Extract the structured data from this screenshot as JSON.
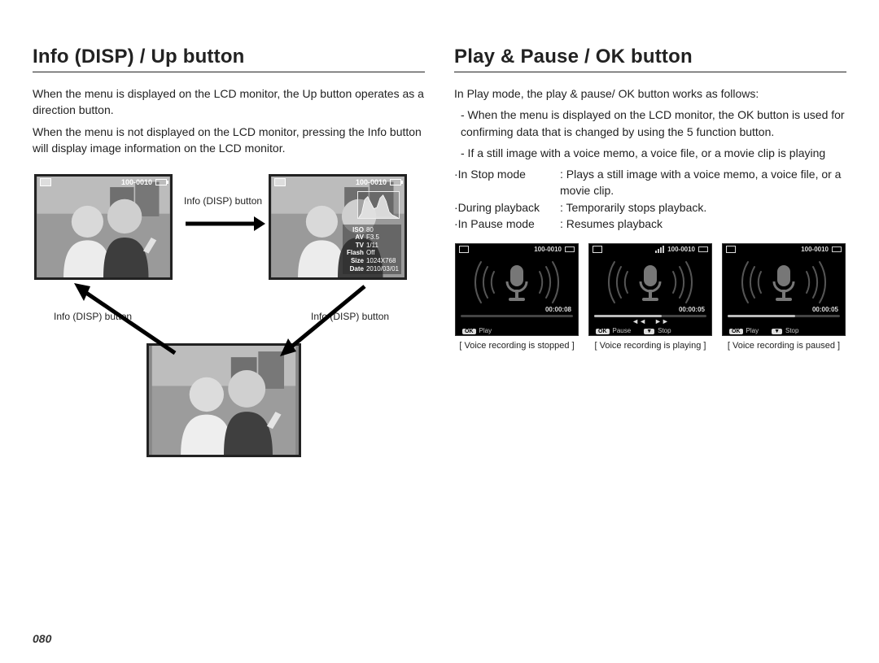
{
  "page_number": "080",
  "left": {
    "heading": "Info (DISP) / Up button",
    "p1": "When the menu is displayed on the LCD monitor, the Up button operates as a direction button.",
    "p2": "When the menu is not displayed on the LCD monitor, pressing the Info button will display image information on the LCD monitor.",
    "diagram": {
      "label_right": "Info (DISP) button",
      "label_bl": "Info (DISP) button",
      "label_br": "Info (DISP) button",
      "file_num": "100-0010",
      "meta": {
        "iso_lbl": "ISO",
        "iso_val": "80",
        "av_lbl": "AV",
        "av_val": "F3.5",
        "tv_lbl": "TV",
        "tv_val": "1/11",
        "flash_lbl": "Flash",
        "flash_val": "Off",
        "size_lbl": "Size",
        "size_val": "1024X768",
        "date_lbl": "Date",
        "date_val": "2010/03/01"
      }
    }
  },
  "right": {
    "heading": "Play & Pause / OK button",
    "p1": "In Play mode, the play & pause/ OK button works as follows:",
    "b1": "- When the menu is displayed on the LCD monitor, the OK button is used for confirming data that is changed by using the 5 function button.",
    "b2": "- If a still image with a voice memo, a voice file, or a movie clip is playing",
    "modes": [
      {
        "label": "·In Stop mode",
        "value": ": Plays a still image with a voice memo, a voice file, or a movie clip."
      },
      {
        "label": "·During playback",
        "value": ": Temporarily stops playback."
      },
      {
        "label": "·In Pause mode",
        "value": ": Resumes playback"
      }
    ],
    "screens": [
      {
        "file_num": "100-0010",
        "time": "00:00:08",
        "progress": 0,
        "show_bars": false,
        "controls": [],
        "footer": [
          {
            "badge": "OK",
            "text": "Play"
          }
        ],
        "caption": "[ Voice recording is stopped ]"
      },
      {
        "file_num": "100-0010",
        "time": "00:00:05",
        "progress": 60,
        "show_bars": true,
        "controls": [
          "◄◄",
          "►►"
        ],
        "footer": [
          {
            "badge": "OK",
            "text": "Pause"
          },
          {
            "badge": "▼",
            "text": "Stop"
          }
        ],
        "caption": "[ Voice recording is playing ]"
      },
      {
        "file_num": "100-0010",
        "time": "00:00:05",
        "progress": 60,
        "show_bars": false,
        "controls": [],
        "footer": [
          {
            "badge": "OK",
            "text": "Play"
          },
          {
            "badge": "▼",
            "text": "Stop"
          }
        ],
        "caption": "[ Voice recording is paused ]"
      }
    ]
  }
}
